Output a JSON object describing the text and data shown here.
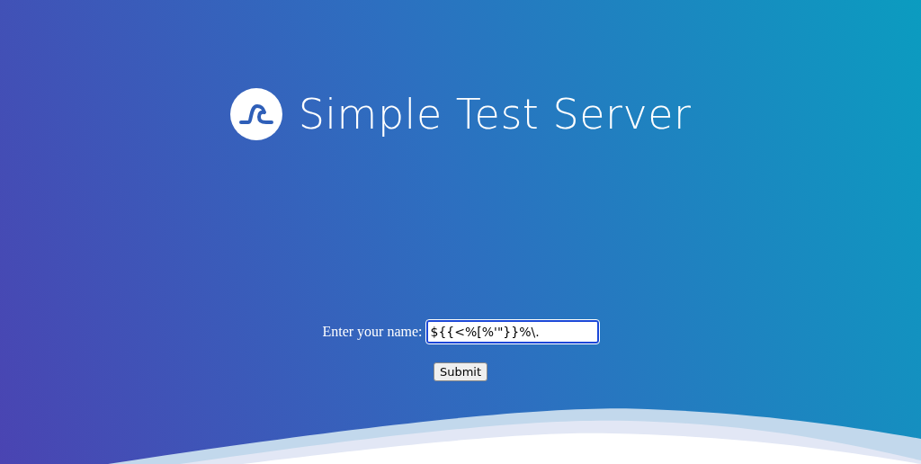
{
  "header": {
    "title": "Simple Test Server"
  },
  "form": {
    "label": "Enter your name:",
    "name_field": {
      "value": "${{<%[%'\"}}%\\."
    },
    "submit_button": "Submit"
  }
}
